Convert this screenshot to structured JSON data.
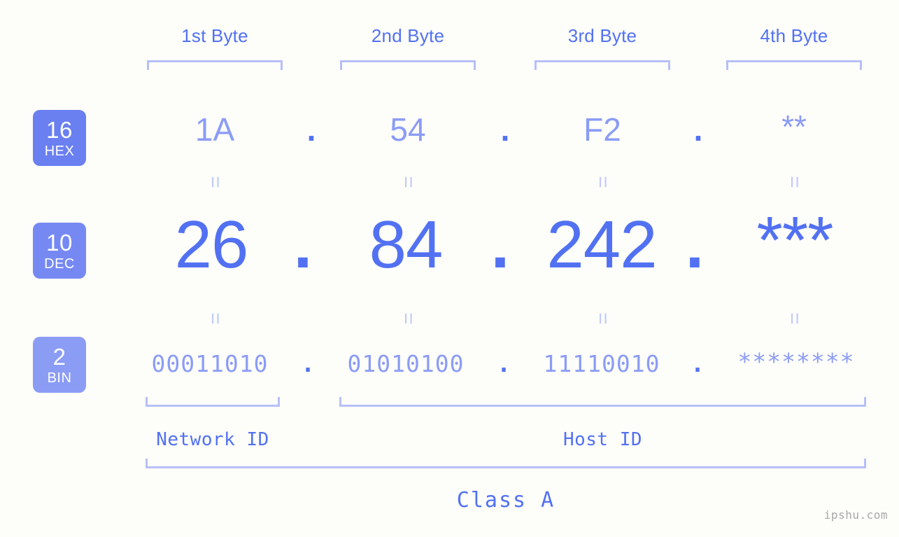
{
  "meta": {
    "background_color": "#fdfdfa",
    "accent_strong": "#5271f2",
    "accent_light": "#8b9cf5",
    "bracket_color": "#b6c0f7",
    "badge_hex_color": "#6a7ff0",
    "badge_dec_color": "#7689f3",
    "badge_bin_color": "#8b9cf5"
  },
  "headers": {
    "byte1": "1st Byte",
    "byte2": "2nd Byte",
    "byte3": "3rd Byte",
    "byte4": "4th Byte"
  },
  "badges": {
    "hex": {
      "num": "16",
      "label": "HEX"
    },
    "dec": {
      "num": "10",
      "label": "DEC"
    },
    "bin": {
      "num": "2",
      "label": "BIN"
    }
  },
  "rows": {
    "hex": {
      "values": [
        "1A",
        "54",
        "F2",
        "**"
      ],
      "separator": "."
    },
    "dec": {
      "values": [
        "26",
        "84",
        "242",
        "***"
      ],
      "separator": "."
    },
    "bin": {
      "values": [
        "00011010",
        "01010100",
        "11110010",
        "********"
      ],
      "separator": "."
    }
  },
  "connectors": {
    "equals": "="
  },
  "sections": {
    "network_id": "Network ID",
    "host_id": "Host ID",
    "class": "Class A"
  },
  "watermark": "ipshu.com"
}
